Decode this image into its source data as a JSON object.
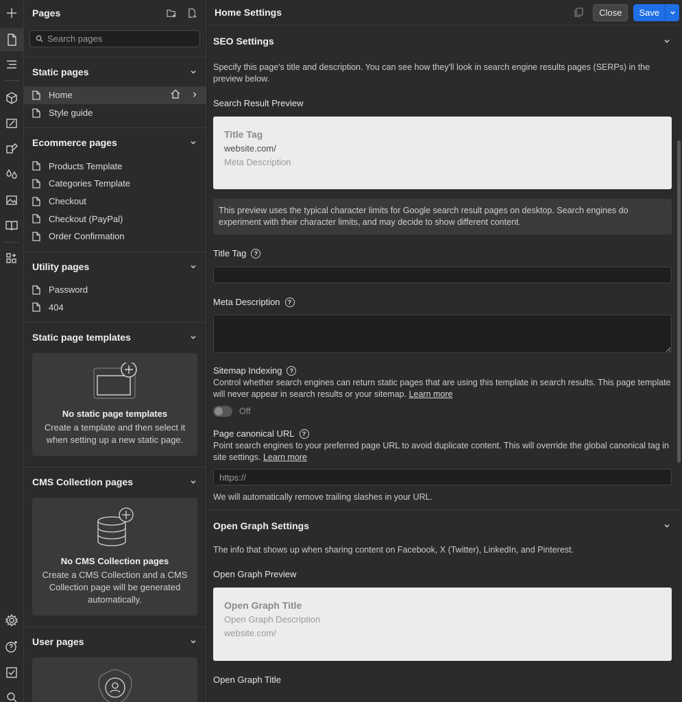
{
  "pages_panel": {
    "title": "Pages",
    "search_placeholder": "Search pages",
    "sections": [
      {
        "title": "Static pages",
        "items": [
          "Home",
          "Style guide"
        ]
      },
      {
        "title": "Ecommerce pages",
        "items": [
          "Products Template",
          "Categories Template",
          "Checkout",
          "Checkout (PayPal)",
          "Order Confirmation"
        ]
      },
      {
        "title": "Utility pages",
        "items": [
          "Password",
          "404"
        ]
      }
    ],
    "static_templates": {
      "title": "Static page templates",
      "empty_title": "No static page templates",
      "empty_desc": "Create a template and then select it when setting up a new static page."
    },
    "cms": {
      "title": "CMS Collection pages",
      "empty_title": "No CMS Collection pages",
      "empty_desc": "Create a CMS Collection and a CMS Collection page will be generated automatically."
    },
    "user_pages": {
      "title": "User pages"
    }
  },
  "header": {
    "title": "Home Settings",
    "close_label": "Close",
    "save_label": "Save"
  },
  "seo": {
    "title": "SEO Settings",
    "intro": "Specify this page's title and description. You can see how they'll look in search engine results pages (SERPs) in the preview below.",
    "preview_label": "Search Result Preview",
    "preview": {
      "title": "Title Tag",
      "url": "website.com/",
      "description": "Meta Description"
    },
    "note": "This preview uses the typical character limits for Google search result pages on desktop. Search engines do experiment with their character limits, and may decide to show different content.",
    "title_tag_label": "Title Tag",
    "meta_desc_label": "Meta Description",
    "sitemap_label": "Sitemap Indexing",
    "sitemap_desc": "Control whether search engines can return static pages that are using this template in search results. This page template will never appear in search results or your sitemap.",
    "learn_more": "Learn more",
    "toggle_label": "Off",
    "canonical_label": "Page canonical URL",
    "canonical_desc": "Point search engines to your preferred page URL to avoid duplicate content. This will override the global canonical tag in site settings.",
    "canonical_placeholder": "https://",
    "canonical_note": "We will automatically remove trailing slashes in your URL."
  },
  "og": {
    "title": "Open Graph Settings",
    "intro": "The info that shows up when sharing content on Facebook, X (Twitter), LinkedIn, and Pinterest.",
    "preview_label": "Open Graph Preview",
    "preview": {
      "title": "Open Graph Title",
      "description": "Open Graph Description",
      "url": "website.com/"
    },
    "og_title_label": "Open Graph Title"
  }
}
